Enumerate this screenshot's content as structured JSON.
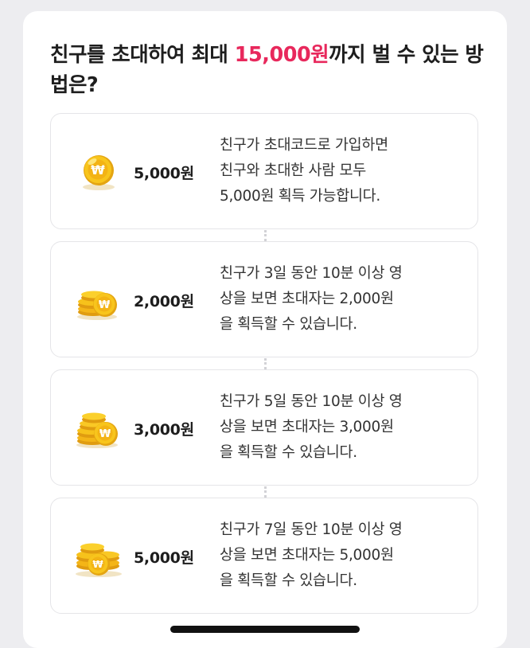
{
  "heading": {
    "prefix": "친구를 초대하여 최대 ",
    "highlight": "15,000원",
    "suffix": "까지 벌 수 있는 방법은?"
  },
  "colors": {
    "accent": "#e8285c",
    "coin": "#f3bf17"
  },
  "steps": [
    {
      "icon": "single-coin-icon",
      "amount": "5,000원",
      "desc": "친구가 초대코드로 가입하면\n친구와 초대한 사람 모두\n5,000원 획득 가능합니다."
    },
    {
      "icon": "coin-stack-small-icon",
      "amount": "2,000원",
      "desc": "친구가 3일 동안 10분 이상 영\n상을 보면 초대자는 2,000원\n을 획득할 수 있습니다."
    },
    {
      "icon": "coin-stack-medium-icon",
      "amount": "3,000원",
      "desc": "친구가 5일 동안 10분 이상 영\n상을 보면 초대자는 3,000원\n을 획득할 수 있습니다."
    },
    {
      "icon": "coin-pile-large-icon",
      "amount": "5,000원",
      "desc": "친구가 7일 동안 10분 이상 영\n상을 보면 초대자는 5,000원\n을 획득할 수 있습니다."
    }
  ]
}
